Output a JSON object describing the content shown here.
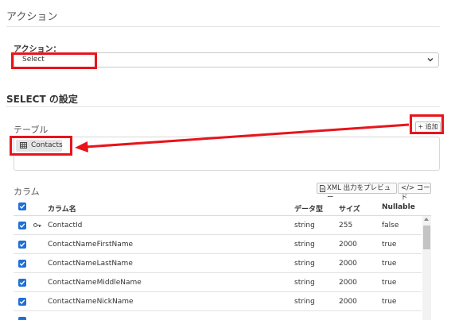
{
  "action_section": {
    "title": "アクション",
    "label": "アクション：",
    "selected": "Select"
  },
  "select_config": {
    "title": "SELECT の設定",
    "table_label": "テーブル",
    "add_button": "+ 追加",
    "table_chip": "Contacts"
  },
  "columns": {
    "label": "カラム",
    "preview_button": "XML 出力をプレビュー",
    "code_button": "</> コード",
    "headers": {
      "name": "カラム名",
      "type": "データ型",
      "size": "サイズ",
      "nullable": "Nullable"
    },
    "rows": [
      {
        "name": "ContactId",
        "type": "string",
        "size": "255",
        "nullable": "false"
      },
      {
        "name": "ContactNameFirstName",
        "type": "string",
        "size": "2000",
        "nullable": "true"
      },
      {
        "name": "ContactNameLastName",
        "type": "string",
        "size": "2000",
        "nullable": "true"
      },
      {
        "name": "ContactNameMiddleName",
        "type": "string",
        "size": "2000",
        "nullable": "true"
      },
      {
        "name": "ContactNameNickName",
        "type": "string",
        "size": "2000",
        "nullable": "true"
      }
    ]
  },
  "colors": {
    "accent": "#1f6fd6",
    "highlight": "#e8141b"
  }
}
